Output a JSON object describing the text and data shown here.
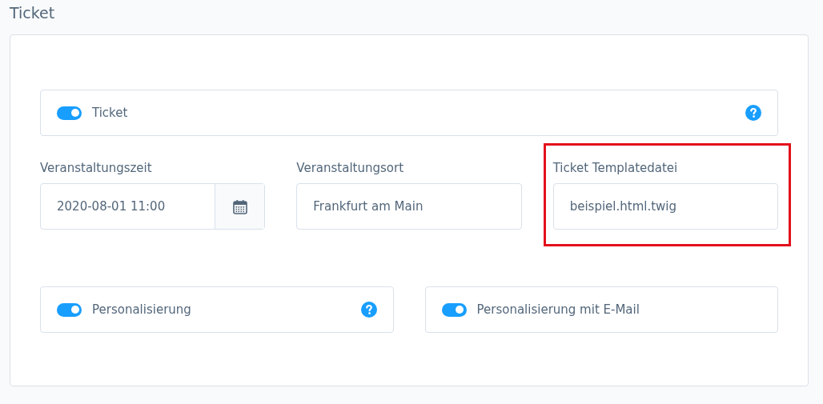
{
  "heading": "Ticket",
  "main_toggle": {
    "label": "Ticket",
    "on": true,
    "help": true
  },
  "fields": [
    {
      "kind": "date",
      "label": "Veranstaltungszeit",
      "value": "2020-08-01 11:00",
      "highlighted": false
    },
    {
      "kind": "text",
      "label": "Veranstaltungsort",
      "value": "Frankfurt am Main",
      "highlighted": false
    },
    {
      "kind": "text",
      "label": "Ticket Templatedatei",
      "value": "beispiel.html.twig",
      "highlighted": true
    }
  ],
  "toggles": [
    {
      "label": "Personalisierung",
      "on": true,
      "help": true
    },
    {
      "label": "Personalisierung mit E-Mail",
      "on": true,
      "help": false
    }
  ]
}
